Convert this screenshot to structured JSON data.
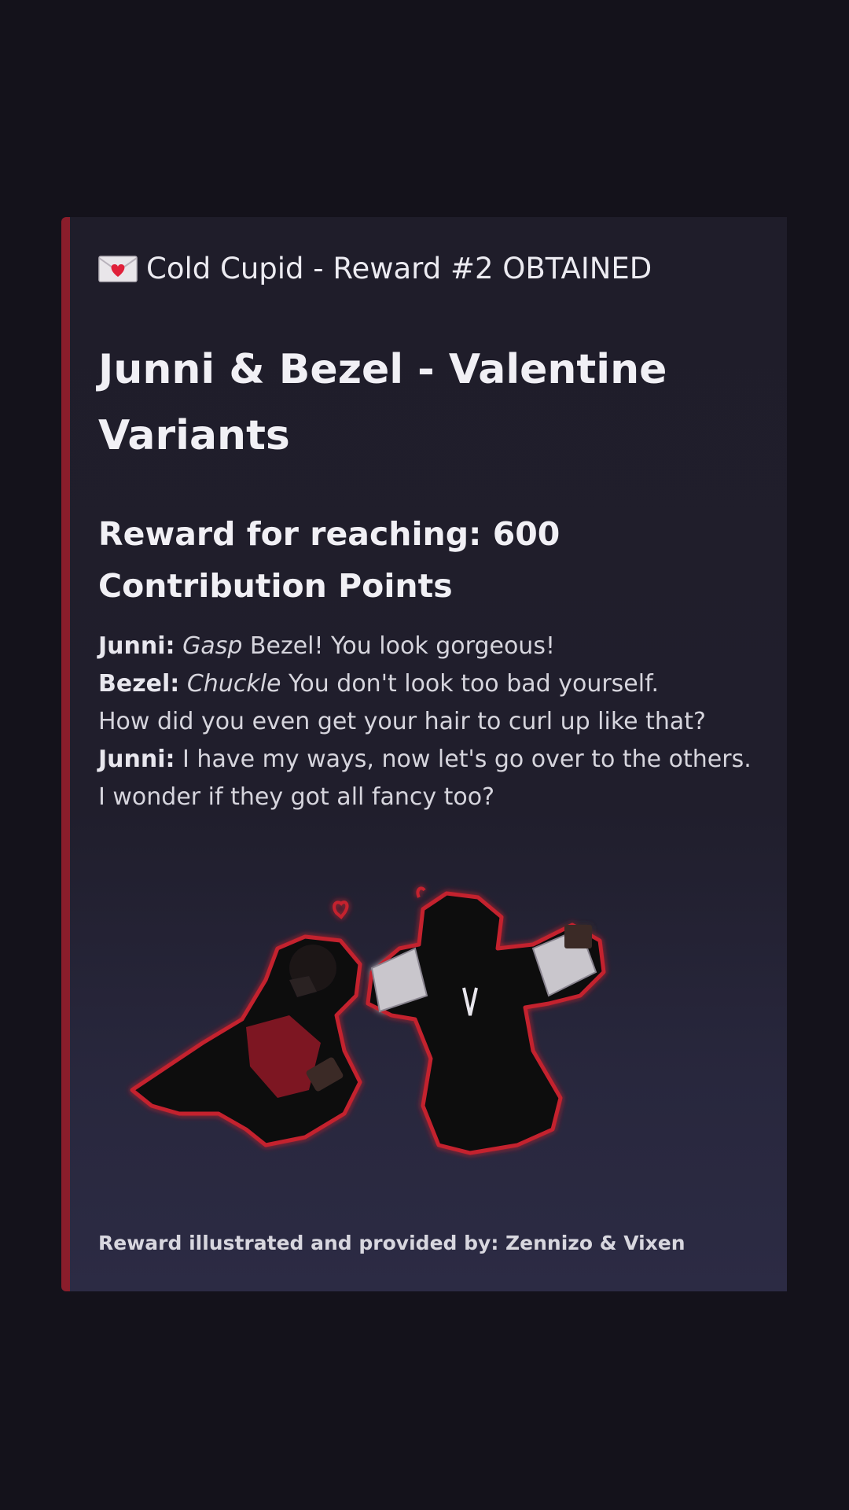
{
  "embed": {
    "accent_color": "#8a1d2b",
    "author": {
      "icon": "love-letter-icon",
      "text": "Cold Cupid - Reward #2 OBTAINED"
    },
    "title": "Junni & Bezel - Valentine Variants",
    "subtitle": "Reward for reaching: 600 Contribution Points",
    "dialogue": [
      {
        "speaker": "Junni:",
        "action": "Gasp",
        "text": " Bezel! You look gorgeous!"
      },
      {
        "speaker": "Bezel:",
        "action": "Chuckle",
        "text": " You don't look too bad yourself."
      },
      {
        "speaker": "",
        "action": "",
        "text": "How did you even get your hair to curl up like that?"
      },
      {
        "speaker": "Junni:",
        "action": "",
        "text": " I have my ways, now let's go over to the others. I wonder if they got all fancy too?"
      }
    ],
    "footer": "Reward illustrated and provided by: Zennizo & Vixen"
  }
}
